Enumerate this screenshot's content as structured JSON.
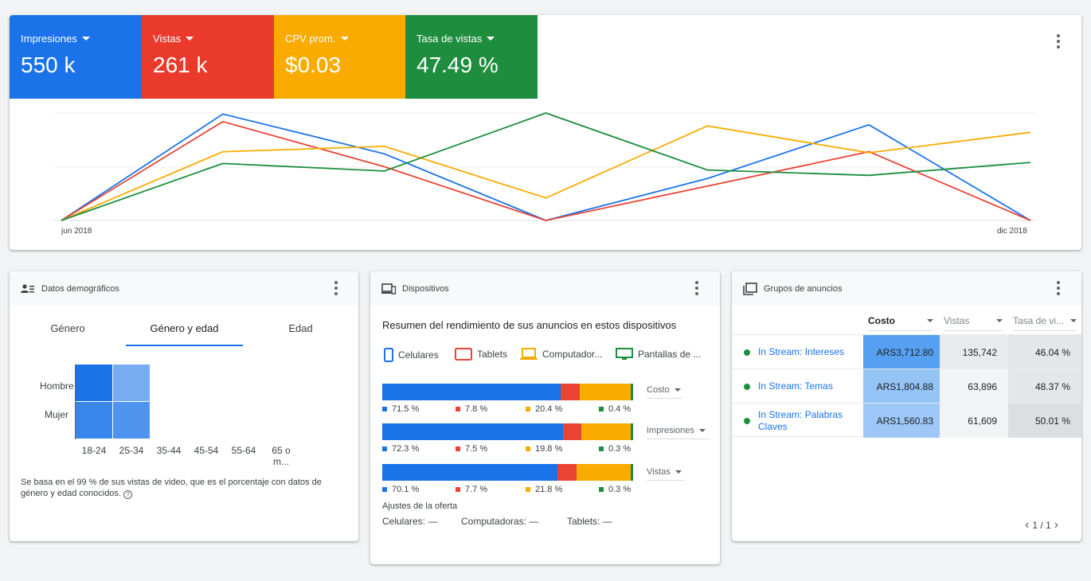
{
  "top": {
    "metrics": [
      {
        "label": "Impresiones",
        "value": "550 k",
        "color": "#1a73e8"
      },
      {
        "label": "Vistas",
        "value": "261 k",
        "color": "#ea3a2c"
      },
      {
        "label": "CPV prom.",
        "value": "$0.03",
        "color": "#f9ab00"
      },
      {
        "label": "Tasa de vistas",
        "value": "47.49 %",
        "color": "#1e8e3e"
      }
    ],
    "chart_data": {
      "type": "line",
      "x_start_label": "jun 2018",
      "x_end_label": "dic 2018",
      "x": [
        0,
        1,
        2,
        3,
        4,
        5,
        6
      ],
      "series": [
        {
          "color": "#1a73e8",
          "values": [
            0,
            0.99,
            0.62,
            0,
            0.39,
            0.89,
            0
          ]
        },
        {
          "color": "#ea4335",
          "values": [
            0,
            0.92,
            0.5,
            0,
            0.32,
            0.64,
            0
          ]
        },
        {
          "color": "#f9ab00",
          "values": [
            0,
            0.64,
            0.69,
            0.21,
            0.88,
            0.63,
            0.82
          ]
        },
        {
          "color": "#1e8e3e",
          "values": [
            0,
            0.53,
            0.46,
            1.0,
            0.47,
            0.42,
            0.54
          ]
        }
      ],
      "ylim": [
        0,
        1
      ]
    }
  },
  "demographics": {
    "title": "Datos demográficos",
    "tabs": [
      "Género",
      "Género y edad",
      "Edad"
    ],
    "active_tab": 1,
    "rows": [
      "Hombre",
      "Mujer"
    ],
    "columns": [
      "18-24",
      "25-34",
      "35-44",
      "45-54",
      "55-64",
      "65 o m..."
    ],
    "heat": [
      [
        1.0,
        0.55,
        0,
        0,
        0,
        0
      ],
      [
        0.85,
        0.75,
        0,
        0,
        0,
        0
      ]
    ],
    "note": "Se basa en el 99 % de sus vistas de video, que es el porcentaje con datos de género y edad conocidos.",
    "help_glyph": "?"
  },
  "devices": {
    "title": "Dispositivos",
    "subtitle": "Resumen del rendimiento de sus anuncios en estos dispositivos",
    "legend": [
      {
        "label": "Celulares",
        "color": "#1a73e8"
      },
      {
        "label": "Tablets",
        "color": "#ea4335"
      },
      {
        "label": "Computador...",
        "color": "#f9ab00"
      },
      {
        "label": "Pantallas de ...",
        "color": "#1e8e3e"
      }
    ],
    "bars": [
      {
        "metric": "Costo",
        "values": [
          71.5,
          7.8,
          20.4,
          0.4
        ],
        "labels": [
          "71.5 %",
          "7.8 %",
          "20.4 %",
          "0.4 %"
        ]
      },
      {
        "metric": "Impresiones",
        "values": [
          72.3,
          7.5,
          19.8,
          0.3
        ],
        "labels": [
          "72.3 %",
          "7.5 %",
          "19.8 %",
          "0.3 %"
        ]
      },
      {
        "metric": "Vistas",
        "values": [
          70.1,
          7.7,
          21.8,
          0.3
        ],
        "labels": [
          "70.1 %",
          "7.7 %",
          "21.8 %",
          "0.3 %"
        ]
      }
    ],
    "bid_title": "Ajustes de la oferta",
    "bid_adjustments": [
      {
        "label": "Celulares: —"
      },
      {
        "label": "Computadoras: —"
      },
      {
        "label": "Tablets: —"
      }
    ]
  },
  "ad_groups": {
    "title": "Grupos de anuncios",
    "columns": [
      "Costo",
      "Vistas",
      "Tasa de vi..."
    ],
    "rows": [
      {
        "name": "In Stream: Intereses",
        "cost": "ARS3,712.80",
        "views": "135,742",
        "rate": "46.04 %",
        "cost_level": 1.0
      },
      {
        "name": "In Stream: Temas",
        "cost": "ARS1,804.88",
        "views": "63,896",
        "rate": "48.37 %",
        "cost_level": 0.49
      },
      {
        "name": "In Stream: Palabras Claves",
        "cost": "ARS1,560.83",
        "views": "61,609",
        "rate": "50.01 %",
        "cost_level": 0.42
      }
    ],
    "pagination": "1 / 1"
  }
}
